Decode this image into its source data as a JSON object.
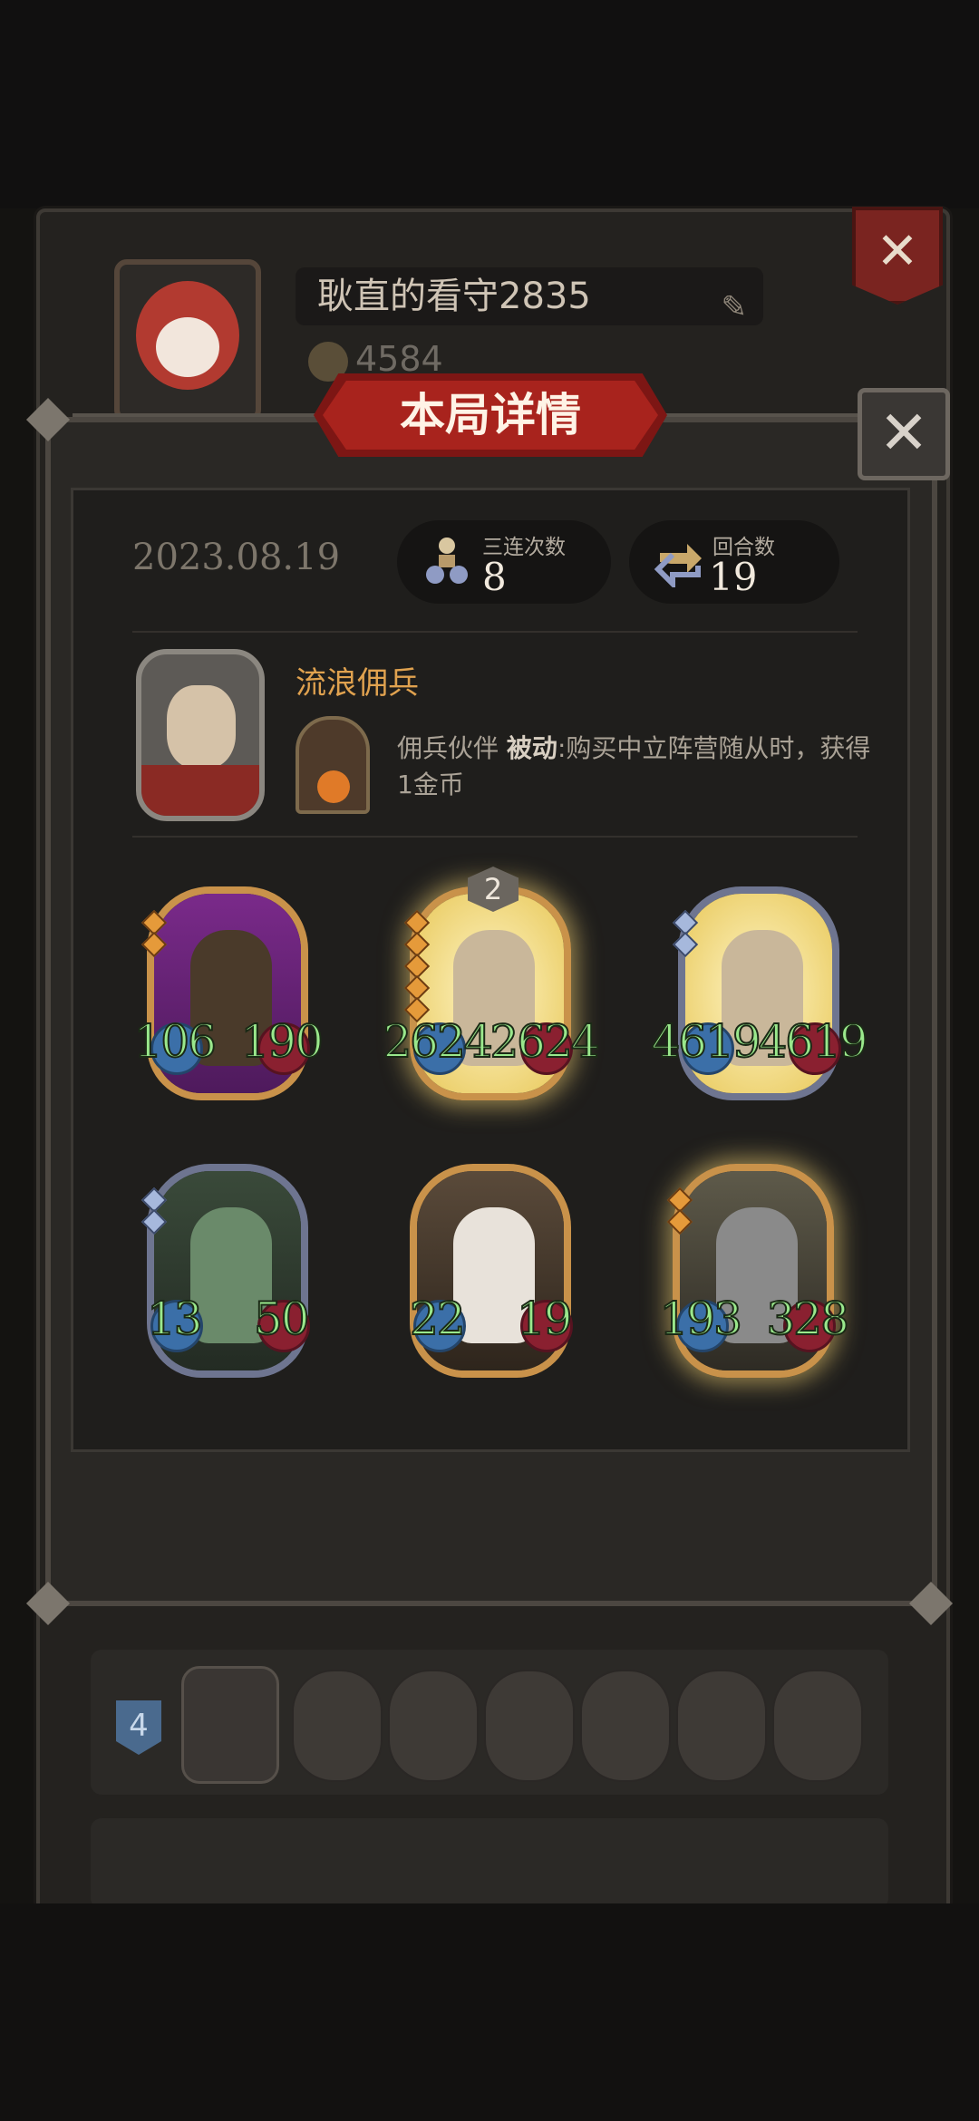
{
  "profile": {
    "name": "耿直的看守2835",
    "gold": "4584"
  },
  "dialog": {
    "title": "本局详情",
    "date": "2023.08.19",
    "stats": [
      {
        "label": "三连次数",
        "value": "8",
        "icon": "triple-icon"
      },
      {
        "label": "回合数",
        "value": "19",
        "icon": "rounds-icon"
      }
    ],
    "hero": {
      "name": "流浪佣兵",
      "skill_name": "佣兵伙伴",
      "skill_type": "被动",
      "skill_desc": ":购买中立阵营随从时，获得1金币"
    },
    "units": [
      {
        "atk": "106",
        "hp": "190",
        "frame": "gold",
        "stars": 2,
        "star_color": "gold",
        "level": ""
      },
      {
        "atk": "2624",
        "hp": "2624",
        "frame": "gold",
        "stars": 5,
        "star_color": "gold",
        "level": "2"
      },
      {
        "atk": "4619",
        "hp": "4619",
        "frame": "silver",
        "stars": 2,
        "star_color": "blue",
        "level": ""
      },
      {
        "atk": "13",
        "hp": "50",
        "frame": "silver",
        "stars": 2,
        "star_color": "blue",
        "level": ""
      },
      {
        "atk": "22",
        "hp": "19",
        "frame": "gold",
        "stars": 0,
        "star_color": "gold",
        "level": ""
      },
      {
        "atk": "193",
        "hp": "328",
        "frame": "gold",
        "stars": 2,
        "star_color": "gold",
        "level": ""
      }
    ]
  },
  "history": {
    "rank": "4"
  },
  "colors": {
    "accent_red": "#a8231d",
    "stat_green": "#9ae88c",
    "hero_name_orange": "#e0a24f"
  }
}
